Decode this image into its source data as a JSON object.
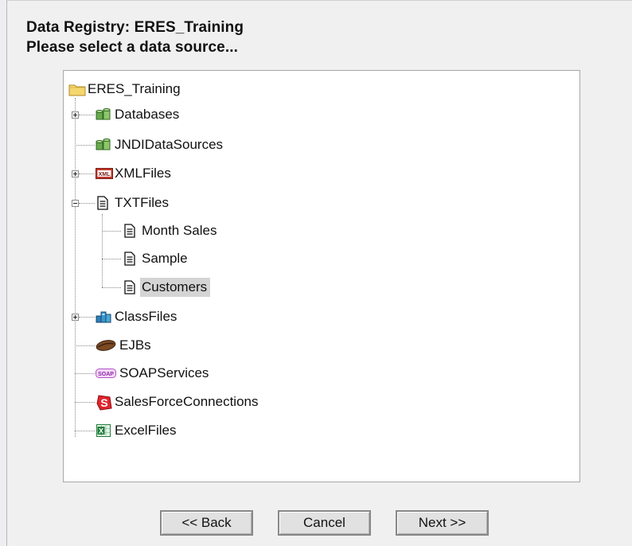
{
  "header": {
    "line1": "Data Registry: ERES_Training",
    "line2": "Please select a data source..."
  },
  "tree": {
    "root": {
      "label": "ERES_Training",
      "icon": "folder-icon"
    },
    "items": [
      {
        "label": "Databases",
        "icon": "database-icon",
        "expandable": true,
        "expanded": false
      },
      {
        "label": "JNDIDataSources",
        "icon": "database-icon",
        "expandable": false
      },
      {
        "label": "XMLFiles",
        "icon": "xml-icon",
        "icon_text": "XML",
        "expandable": true,
        "expanded": false
      },
      {
        "label": "TXTFiles",
        "icon": "text-file-icon",
        "expandable": true,
        "expanded": true,
        "children": [
          {
            "label": "Month Sales",
            "icon": "text-file-icon"
          },
          {
            "label": "Sample",
            "icon": "text-file-icon"
          },
          {
            "label": "Customers",
            "icon": "text-file-icon",
            "selected": true
          }
        ]
      },
      {
        "label": "ClassFiles",
        "icon": "class-files-icon",
        "expandable": true,
        "expanded": false
      },
      {
        "label": "EJBs",
        "icon": "bean-icon",
        "expandable": false
      },
      {
        "label": "SOAPServices",
        "icon": "soap-icon",
        "icon_text": "SOAP",
        "expandable": false
      },
      {
        "label": "SalesForceConnections",
        "icon": "salesforce-icon",
        "icon_text": "S",
        "expandable": false
      },
      {
        "label": "ExcelFiles",
        "icon": "excel-icon",
        "icon_text": "X",
        "expandable": false
      }
    ]
  },
  "buttons": {
    "back": "<< Back",
    "cancel": "Cancel",
    "next": "Next >>"
  },
  "colors": {
    "selection": "#d4d4d4",
    "folder": "#f5d76e",
    "database": "#6aa84f",
    "xml": "#c0392b",
    "salesforce": "#e0252d",
    "excel": "#1e7d3a",
    "soap": "#b455c8"
  }
}
